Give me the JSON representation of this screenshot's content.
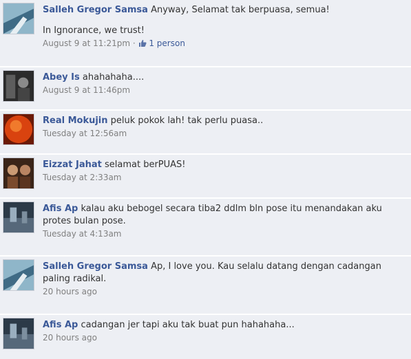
{
  "comments": [
    {
      "author": "Salleh Gregor Samsa",
      "text": "Anyway, Selamat tak berpuasa, semua!",
      "text2": "In Ignorance, we trust!",
      "time": "August 9 at 11:21pm",
      "dot": "·",
      "likes": "1 person"
    },
    {
      "author": "Abey Is",
      "text": "ahahahaha....",
      "time": "August 9 at 11:46pm"
    },
    {
      "author": "Real Mokujin",
      "text": "peluk pokok lah! tak perlu puasa..",
      "time": "Tuesday at 12:56am"
    },
    {
      "author": "Eizzat Jahat",
      "text": "selamat berPUAS!",
      "time": "Tuesday at 2:33am"
    },
    {
      "author": "Afis Ap",
      "text": "kalau aku bebogel secara tiba2 ddlm bln pose itu menandakan aku protes bulan pose.",
      "time": "Tuesday at 4:13am"
    },
    {
      "author": "Salleh Gregor Samsa",
      "text": "Ap, I love you. Kau selalu datang dengan cadangan paling radikal.",
      "time": "20 hours ago"
    },
    {
      "author": "Afis Ap",
      "text": "cadangan jer tapi aku tak buat pun hahahaha...",
      "time": "20 hours ago"
    }
  ],
  "icons": {
    "like": "thumbs-up-icon"
  },
  "colors": {
    "author": "#3b5998",
    "background": "#edeff4",
    "timestamp": "#808080"
  }
}
